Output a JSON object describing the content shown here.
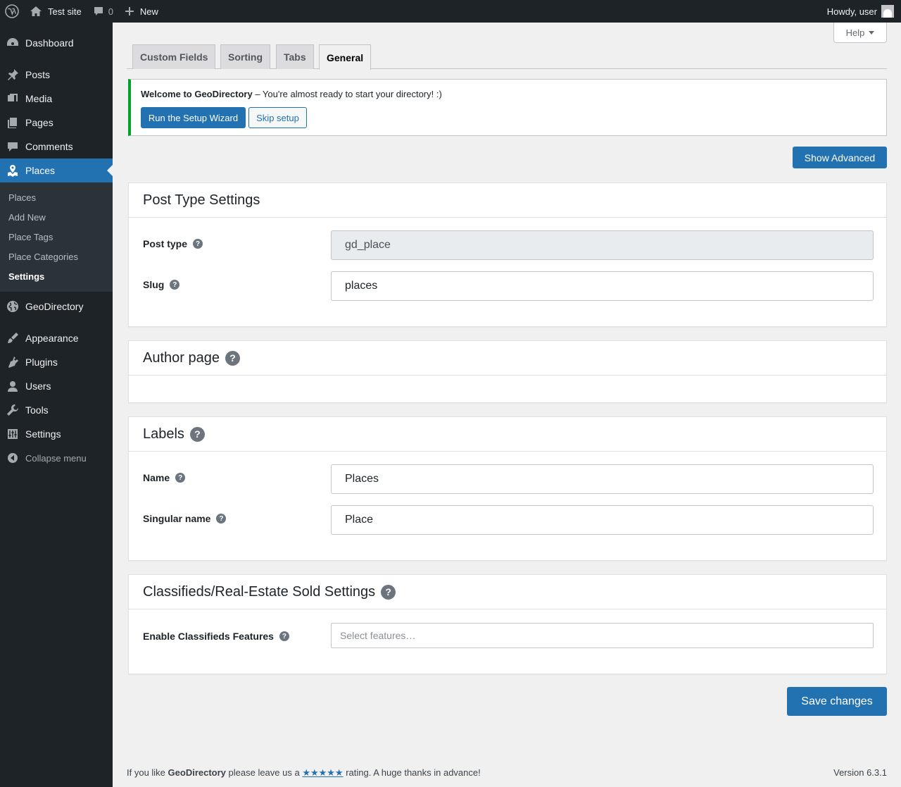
{
  "adminbar": {
    "wp_logo_icon": "wordpress-icon",
    "site_name": "Test site",
    "comments_count": "0",
    "new_label": "New",
    "howdy": "Howdy, user"
  },
  "menu": {
    "items": [
      {
        "label": "Dashboard",
        "icon": "dashboard-icon"
      },
      {
        "label": "Posts",
        "icon": "pin-icon"
      },
      {
        "label": "Media",
        "icon": "media-icon"
      },
      {
        "label": "Pages",
        "icon": "pages-icon"
      },
      {
        "label": "Comments",
        "icon": "comment-icon"
      },
      {
        "label": "Places",
        "icon": "map-icon"
      },
      {
        "label": "GeoDirectory",
        "icon": "globe-icon"
      },
      {
        "label": "Appearance",
        "icon": "brush-icon"
      },
      {
        "label": "Plugins",
        "icon": "plugin-icon"
      },
      {
        "label": "Users",
        "icon": "user-icon"
      },
      {
        "label": "Tools",
        "icon": "wrench-icon"
      },
      {
        "label": "Settings",
        "icon": "settings-icon"
      }
    ],
    "submenu": [
      "Places",
      "Add New",
      "Place Tags",
      "Place Categories",
      "Settings"
    ],
    "collapse": "Collapse menu"
  },
  "help": "Help",
  "tabs": [
    "Custom Fields",
    "Sorting",
    "Tabs",
    "General"
  ],
  "notice": {
    "bold": "Welcome to GeoDirectory",
    "text": " – You're almost ready to start your directory! :)",
    "primary_button": "Run the Setup Wizard",
    "secondary_button": "Skip setup"
  },
  "show_advanced": "Show Advanced",
  "sections": {
    "post_type": {
      "title": "Post Type Settings",
      "post_type_label": "Post type",
      "post_type_value": "gd_place",
      "slug_label": "Slug",
      "slug_value": "places"
    },
    "author": {
      "title": "Author page"
    },
    "labels": {
      "title": "Labels",
      "name_label": "Name",
      "name_value": "Places",
      "singular_label": "Singular name",
      "singular_value": "Place"
    },
    "classifieds": {
      "title": "Classifieds/Real-Estate Sold Settings",
      "features_label": "Enable Classifieds Features",
      "features_placeholder": "Select features…"
    }
  },
  "save": "Save changes",
  "footer": {
    "pre": "If you like ",
    "brand": "GeoDirectory",
    "mid": " please leave us a ",
    "stars": "★★★★★",
    "post": " rating. A huge thanks in advance!",
    "version": "Version 6.3.1"
  },
  "colors": {
    "accent": "#2271b1",
    "notice_border": "#00a32a",
    "menu_bg": "#1d2327"
  }
}
